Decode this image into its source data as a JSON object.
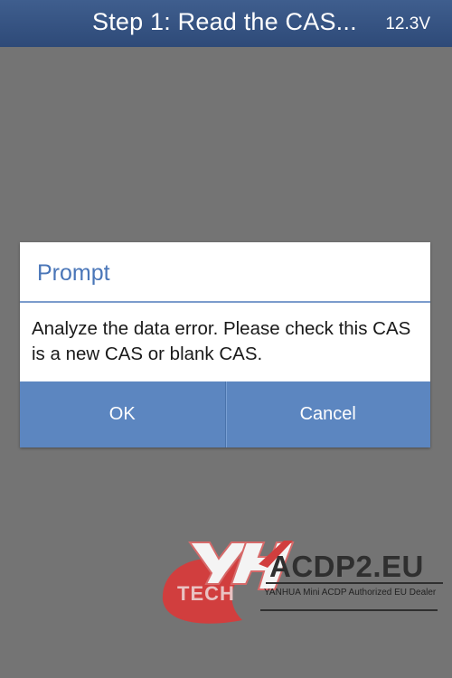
{
  "header": {
    "title": "Step 1: Read the CAS...",
    "voltage": "12.3V"
  },
  "dialog": {
    "title": "Prompt",
    "message": "Analyze the data error. Please check this CAS is a new CAS or blank CAS.",
    "ok_label": "OK",
    "cancel_label": "Cancel"
  },
  "watermark": {
    "logo_text": "TECH",
    "brand": "ACDP2.EU",
    "tagline": "YANHUA Mini ACDP Authorized EU Dealer"
  },
  "colors": {
    "header_bg": "#34517f",
    "overlay_bg": "#747474",
    "dialog_title": "#4a76b8",
    "button_bg": "#5c86c0",
    "logo_red": "#d93a3a"
  }
}
